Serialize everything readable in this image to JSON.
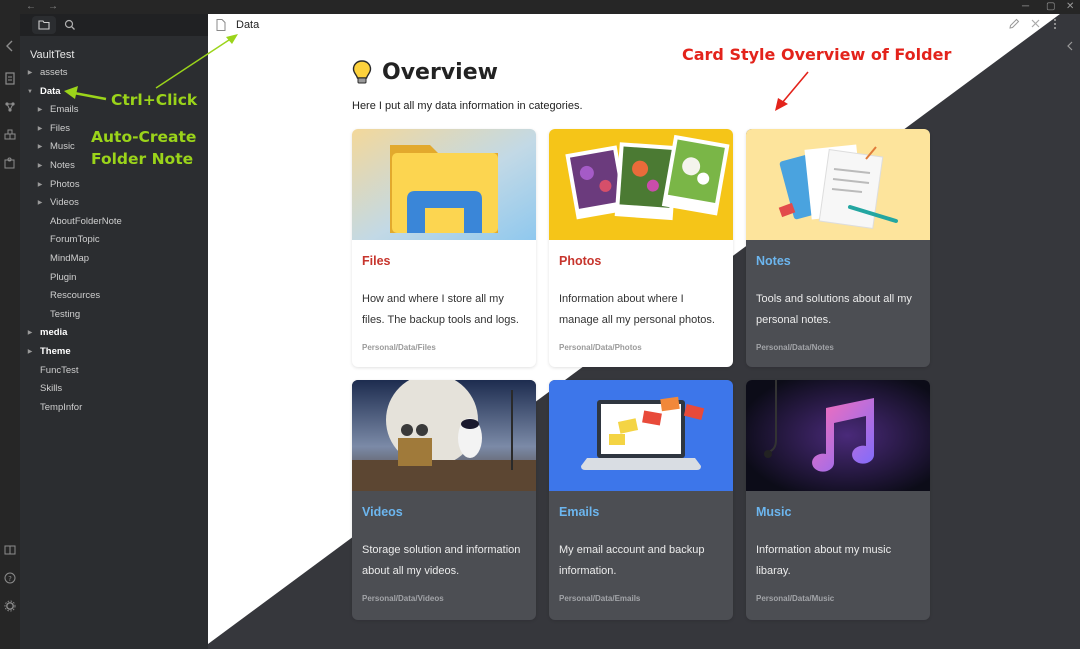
{
  "window": {
    "back": "←",
    "forward": "→",
    "minimize": "─",
    "maximize": "▢",
    "close": "✕"
  },
  "ribbon": {
    "collapse_icon": "chevron-left-icon",
    "icons": [
      "file-icon",
      "graph-icon",
      "blocks-icon",
      "puzzle-icon",
      "book-icon",
      "help-icon",
      "gear-icon"
    ]
  },
  "sidebar": {
    "tabs": [
      "folder-icon",
      "search-icon"
    ],
    "vault_name": "VaultTest",
    "items": [
      {
        "label": "assets",
        "depth": 0,
        "expanded": false,
        "has_children": true,
        "bold": false
      },
      {
        "label": "Data",
        "depth": 0,
        "expanded": true,
        "has_children": true,
        "bold": true
      },
      {
        "label": "Emails",
        "depth": 1,
        "expanded": false,
        "has_children": true,
        "bold": false
      },
      {
        "label": "Files",
        "depth": 1,
        "expanded": false,
        "has_children": true,
        "bold": false
      },
      {
        "label": "Music",
        "depth": 1,
        "expanded": false,
        "has_children": true,
        "bold": false
      },
      {
        "label": "Notes",
        "depth": 1,
        "expanded": false,
        "has_children": true,
        "bold": false
      },
      {
        "label": "Photos",
        "depth": 1,
        "expanded": false,
        "has_children": true,
        "bold": false
      },
      {
        "label": "Videos",
        "depth": 1,
        "expanded": false,
        "has_children": true,
        "bold": false
      },
      {
        "label": "AboutFolderNote",
        "depth": 1,
        "expanded": false,
        "has_children": false,
        "bold": false
      },
      {
        "label": "ForumTopic",
        "depth": 1,
        "expanded": false,
        "has_children": false,
        "bold": false
      },
      {
        "label": "MindMap",
        "depth": 1,
        "expanded": false,
        "has_children": false,
        "bold": false
      },
      {
        "label": "Plugin",
        "depth": 1,
        "expanded": false,
        "has_children": false,
        "bold": false
      },
      {
        "label": "Rescources",
        "depth": 1,
        "expanded": false,
        "has_children": false,
        "bold": false
      },
      {
        "label": "Testing",
        "depth": 1,
        "expanded": false,
        "has_children": false,
        "bold": false
      },
      {
        "label": "media",
        "depth": 0,
        "expanded": false,
        "has_children": true,
        "bold": true
      },
      {
        "label": "Theme",
        "depth": 0,
        "expanded": false,
        "has_children": true,
        "bold": true
      },
      {
        "label": "FuncTest",
        "depth": 0,
        "expanded": false,
        "has_children": false,
        "bold": false
      },
      {
        "label": "Skills",
        "depth": 0,
        "expanded": false,
        "has_children": false,
        "bold": false
      },
      {
        "label": "TempInfor",
        "depth": 0,
        "expanded": false,
        "has_children": false,
        "bold": false
      }
    ]
  },
  "tab": {
    "title": "Data",
    "edit_icon": "pencil-icon",
    "close_icon": "close-icon",
    "more_icon": "more-vertical-icon"
  },
  "note": {
    "heading": "Overview",
    "intro": "Here I put all my data information in categories."
  },
  "cards": [
    {
      "title": "Files",
      "desc": "How and where I store all my files. The backup tools and logs.",
      "path": "Personal/Data/Files",
      "theme": "light",
      "image": "folder-icon"
    },
    {
      "title": "Photos",
      "desc": "Information about where I manage all my personal photos.",
      "path": "Personal/Data/Photos",
      "theme": "light",
      "image": "photos-image"
    },
    {
      "title": "Notes",
      "desc": "Tools and solutions about all my personal notes.",
      "path": "Personal/Data/Notes",
      "theme": "dark",
      "image": "notes-image"
    },
    {
      "title": "Videos",
      "desc": "Storage solution and information about all my videos.",
      "path": "Personal/Data/Videos",
      "theme": "dark",
      "image": "video-still-image"
    },
    {
      "title": "Emails",
      "desc": "My email account and backup information.",
      "path": "Personal/Data/Emails",
      "theme": "dark",
      "image": "email-laptop-image"
    },
    {
      "title": "Music",
      "desc": "Information about my music libaray.",
      "path": "Personal/Data/Music",
      "theme": "dark",
      "image": "music-note-image"
    }
  ],
  "annotations": {
    "ctrl_click": "Ctrl+Click",
    "auto_create_1": "Auto-Create",
    "auto_create_2": "Folder Note",
    "card_style": "Card Style Overview of Folder"
  },
  "colors": {
    "annotation_green": "#9bd41a",
    "annotation_red": "#e3231b",
    "card_title_light": "#c7352d",
    "card_title_dark": "#6cb6ef"
  }
}
